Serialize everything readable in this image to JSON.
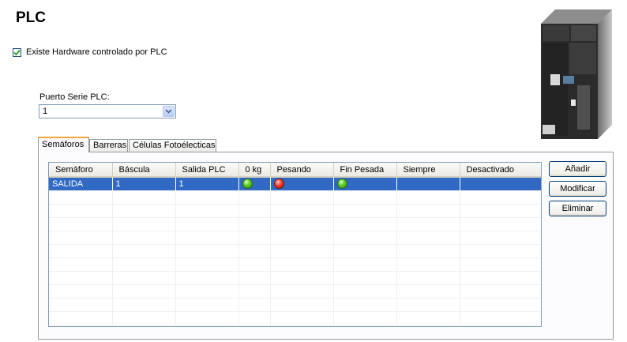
{
  "page": {
    "title": "PLC"
  },
  "hardware_checkbox": {
    "label": "Existe Hardware controlado por PLC",
    "checked": true
  },
  "serial_port": {
    "label": "Puerto Serie PLC:",
    "value": "1"
  },
  "tabs": [
    {
      "label": "Semáforos",
      "active": true
    },
    {
      "label": "Barreras",
      "active": false
    },
    {
      "label": "Células Fotoélecticas",
      "active": false
    }
  ],
  "grid": {
    "columns": [
      "Semáforo",
      "Báscula",
      "Salida PLC",
      "0 kg",
      "Pesando",
      "Fin Pesada",
      "Siempre",
      "Desactivado"
    ],
    "rows": [
      {
        "semaforo": "SALIDA",
        "bascula": "1",
        "salida_plc": "1",
        "cero_kg": "green-light-icon",
        "pesando": "red-light-icon",
        "fin_pesada": "green-light-icon",
        "siempre": "",
        "desactivado": ""
      }
    ]
  },
  "buttons": {
    "add": "Añadir",
    "modify": "Modificar",
    "delete": "Eliminar"
  },
  "colors": {
    "selection": "#316ac5",
    "active_tab_accent": "#f2a53b",
    "light_green": "#5fd02c",
    "light_red": "#f03b2b"
  }
}
